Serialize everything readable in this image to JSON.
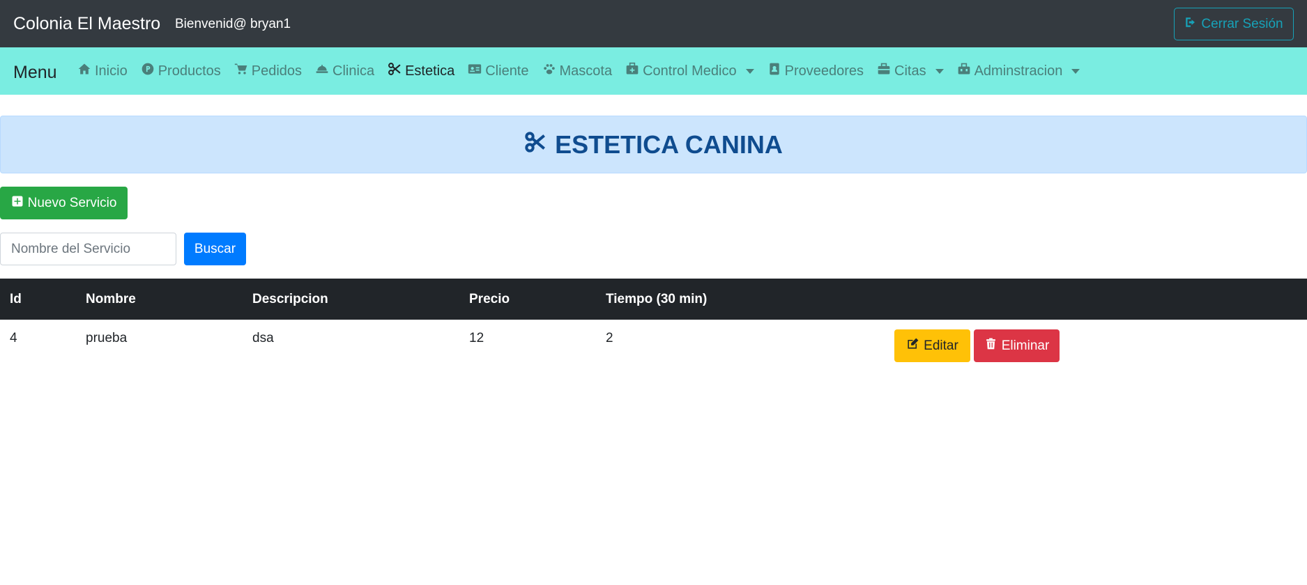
{
  "topbar": {
    "brand": "Colonia El Maestro",
    "welcome": "Bienvenid@ bryan1",
    "logout_label": "Cerrar Sesión",
    "logout_icon": "sign-out-icon"
  },
  "navbar": {
    "menu_title": "Menu",
    "items": [
      {
        "label": "Inicio",
        "icon": "home-icon"
      },
      {
        "label": "Productos",
        "icon": "product-icon"
      },
      {
        "label": "Pedidos",
        "icon": "cart-icon"
      },
      {
        "label": "Clinica",
        "icon": "bell-concierge-icon"
      },
      {
        "label": "Estetica",
        "icon": "scissors-icon",
        "active": true
      },
      {
        "label": "Cliente",
        "icon": "id-card-icon"
      },
      {
        "label": "Mascota",
        "icon": "paw-icon"
      },
      {
        "label": "Control Medico",
        "icon": "medkit-icon",
        "dropdown": true
      },
      {
        "label": "Proveedores",
        "icon": "address-book-icon"
      },
      {
        "label": "Citas",
        "icon": "briefcase-icon",
        "dropdown": true
      },
      {
        "label": "Adminstracion",
        "icon": "toolbox-icon",
        "dropdown": true
      }
    ]
  },
  "banner": {
    "title": "ESTETICA CANINA",
    "icon": "scissors-icon"
  },
  "actions": {
    "new_service_label": "Nuevo Servicio",
    "search_placeholder": "Nombre del Servicio",
    "search_button": "Buscar"
  },
  "table": {
    "headers": [
      "Id",
      "Nombre",
      "Descripcion",
      "Precio",
      "Tiempo (30 min)"
    ],
    "rows": [
      {
        "id": "4",
        "nombre": "prueba",
        "descripcion": "dsa",
        "precio": "12",
        "tiempo": "2"
      }
    ],
    "edit_label": "Editar",
    "delete_label": "Eliminar"
  },
  "colors": {
    "topbar": "#343a40",
    "navbar": "#7aede1",
    "banner": "#cce5fd",
    "success": "#28a745",
    "primary": "#007bff",
    "warning": "#ffc107",
    "danger": "#dc3545",
    "info": "#17a2b8"
  }
}
